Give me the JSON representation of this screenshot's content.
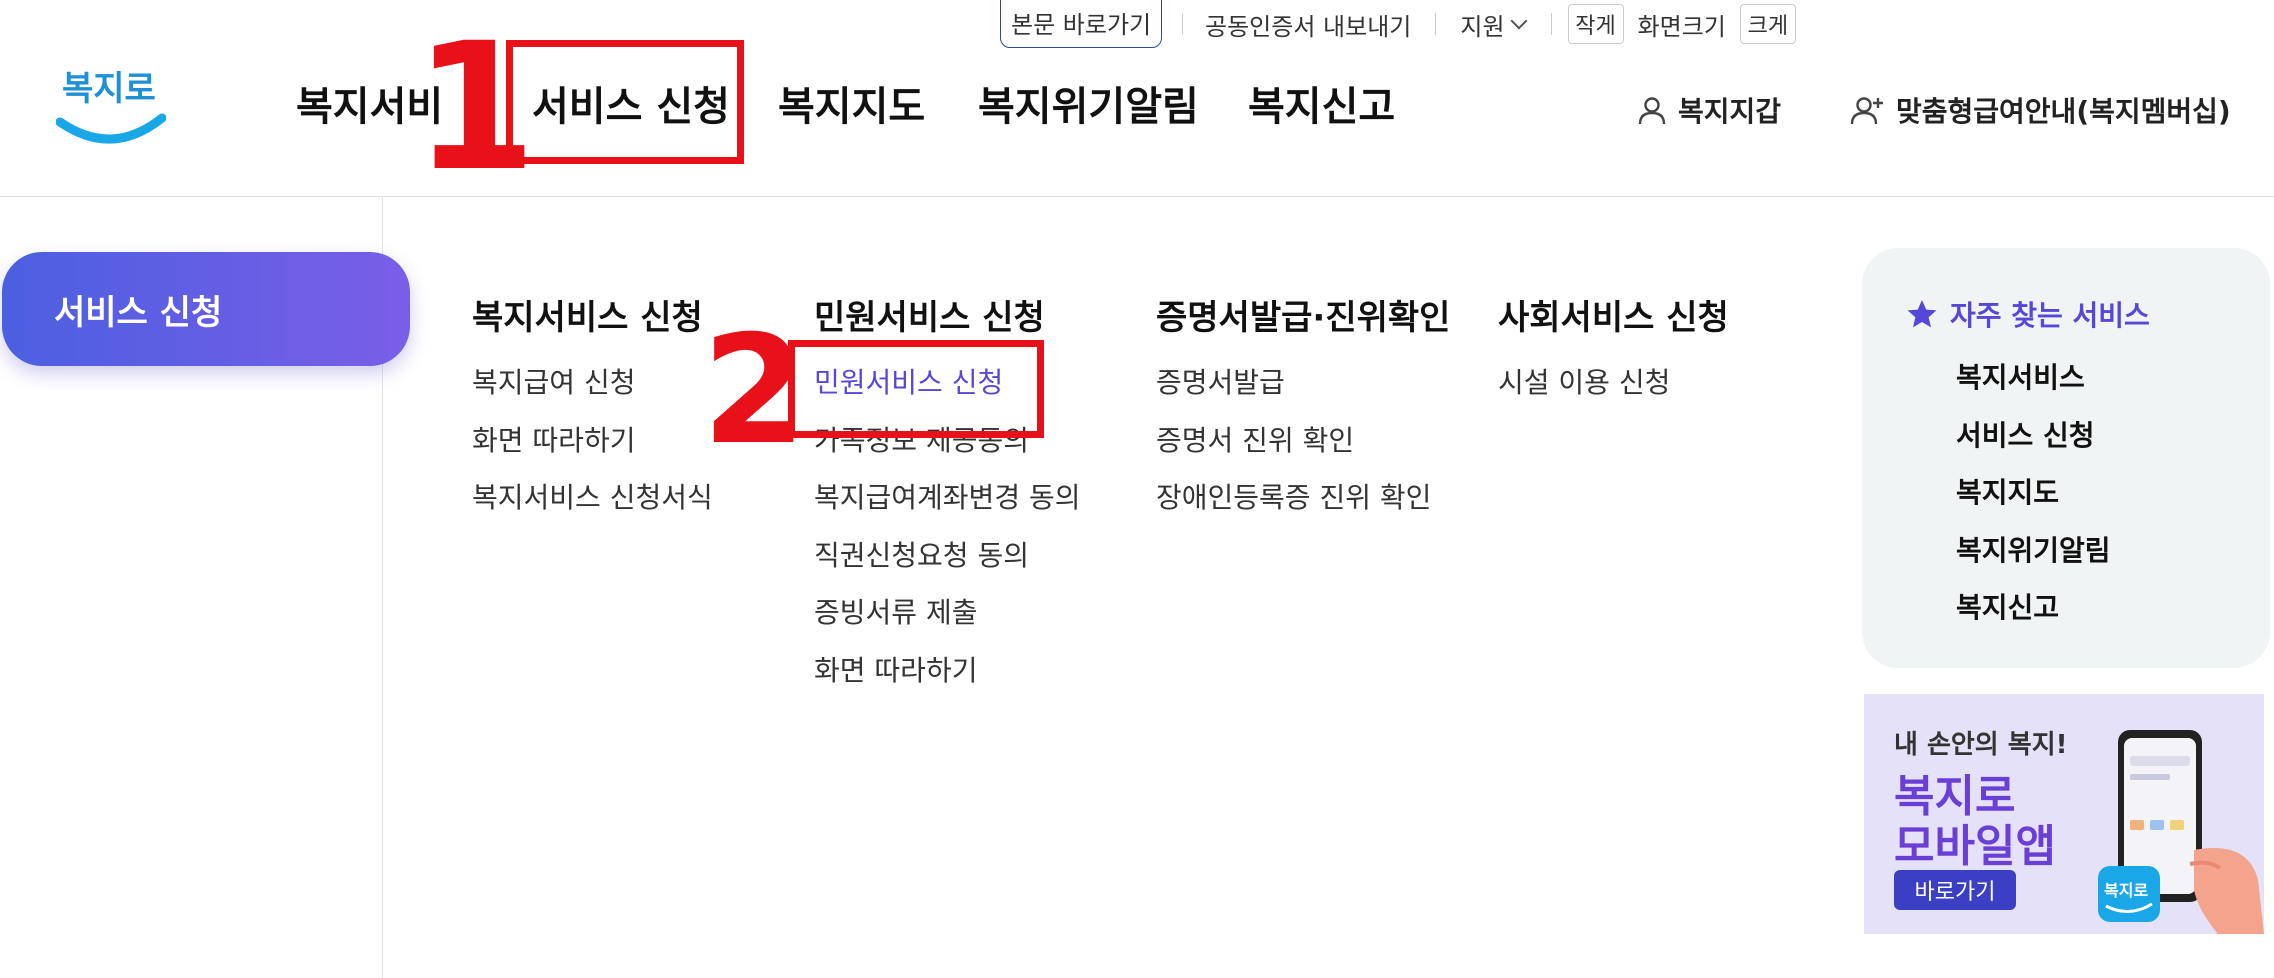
{
  "util": {
    "skip_link": "본문 바로가기",
    "cert_export": "공동인증서 내보내기",
    "support": "지원",
    "zoom_small": "작게",
    "zoom_label": "화면크기",
    "zoom_large": "크게"
  },
  "logo": {
    "text": "복지로"
  },
  "gnb": {
    "items": [
      "복지서비",
      "서비스 신청",
      "복지지도",
      "복지위기알림",
      "복지신고"
    ]
  },
  "header_links": {
    "wallet": "복지지갑",
    "membership": "맞춤형급여안내(복지멤버십)"
  },
  "side": {
    "active": "서비스 신청"
  },
  "menu": {
    "columns": [
      {
        "title": "복지서비스 신청",
        "links": [
          "복지급여 신청",
          "화면 따라하기",
          "복지서비스 신청서식"
        ]
      },
      {
        "title": "민원서비스 신청",
        "links": [
          "민원서비스 신청",
          "가족정보 제공동의",
          "복지급여계좌변경 동의",
          "직권신청요청 동의",
          "증빙서류 제출",
          "화면 따라하기"
        ]
      },
      {
        "title": "증명서발급·진위확인",
        "links": [
          "증명서발급",
          "증명서 진위 확인",
          "장애인등록증 진위 확인"
        ]
      },
      {
        "title": "사회서비스 신청",
        "links": [
          "시설 이용 신청"
        ]
      }
    ]
  },
  "favorites": {
    "title": "자주 찾는 서비스",
    "items": [
      "복지서비스",
      "서비스 신청",
      "복지지도",
      "복지위기알림",
      "복지신고"
    ]
  },
  "banner": {
    "tagline": "내 손안의 복지!",
    "line1": "복지로",
    "line2": "모바일앱",
    "button": "바로가기",
    "phone_logo": "복지로"
  },
  "annotations": {
    "step1": "1",
    "step2": "2"
  },
  "colors": {
    "accent": "#5547d8",
    "annotation": "#e8111a",
    "gradient_start": "#4b5fe0",
    "gradient_end": "#7a5ee8"
  }
}
